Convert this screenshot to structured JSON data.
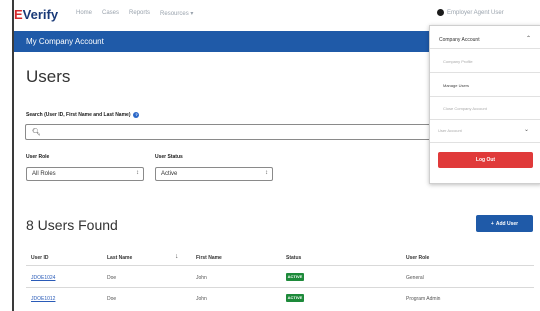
{
  "brand": {
    "logo_prefix": "E",
    "logo_rest": "Verify"
  },
  "nav": {
    "links": [
      "Home",
      "Cases",
      "Reports",
      "Resources"
    ],
    "resources_caret": "▾"
  },
  "user_menu": {
    "label": "Employer Agent User"
  },
  "header": {
    "title": "My Company Account"
  },
  "page": {
    "title": "Users"
  },
  "search": {
    "label": "Search (User ID, First Name and Last Name)",
    "placeholder": ""
  },
  "filters": {
    "role": {
      "label": "User Role",
      "value": "All Roles"
    },
    "status": {
      "label": "User Status",
      "value": "Active"
    }
  },
  "results": {
    "count_text": "8 Users Found",
    "add_label": "Add User"
  },
  "table": {
    "headers": [
      "User ID",
      "Last Name",
      "First Name",
      "Status",
      "User Role"
    ],
    "rows": [
      {
        "id": "JDOE1024",
        "last": "Doe",
        "first": "John",
        "status": "ACTIVE",
        "role": "General"
      },
      {
        "id": "JDOE1012",
        "last": "Doe",
        "first": "John",
        "status": "ACTIVE",
        "role": "Program Admin"
      }
    ]
  },
  "dropdown": {
    "header": "Company Account",
    "items": [
      "Company Profile",
      "Manage Users",
      "Close Company Account"
    ],
    "sub_header": "User Account",
    "logout": "Log Out"
  }
}
